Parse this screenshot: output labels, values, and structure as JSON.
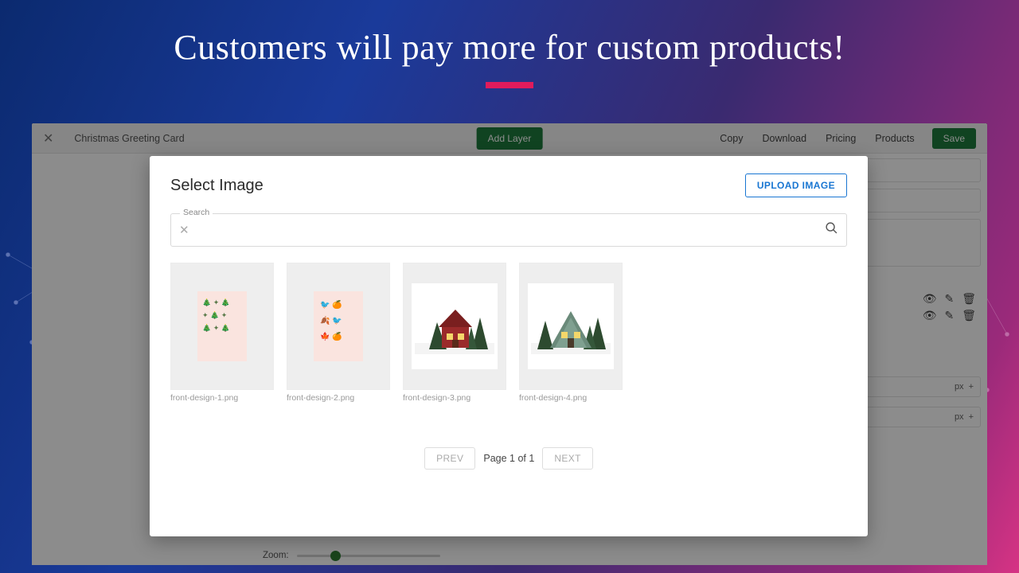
{
  "headline": "Customers will pay more for custom products!",
  "editor": {
    "doc_title": "Christmas Greeting Card",
    "add_layer": "Add Layer",
    "links": {
      "copy": "Copy",
      "download": "Download",
      "pricing": "Pricing",
      "products": "Products"
    },
    "save": "Save",
    "zoom_label": "Zoom:",
    "px_label": "px",
    "plus": "+"
  },
  "modal": {
    "title": "Select Image",
    "upload": "UPLOAD IMAGE",
    "search_label": "Search",
    "thumbs": [
      {
        "name": "front-design-1.png"
      },
      {
        "name": "front-design-2.png"
      },
      {
        "name": "front-design-3.png"
      },
      {
        "name": "front-design-4.png"
      }
    ],
    "pager": {
      "prev": "PREV",
      "info": "Page 1 of 1",
      "next": "NEXT"
    }
  }
}
